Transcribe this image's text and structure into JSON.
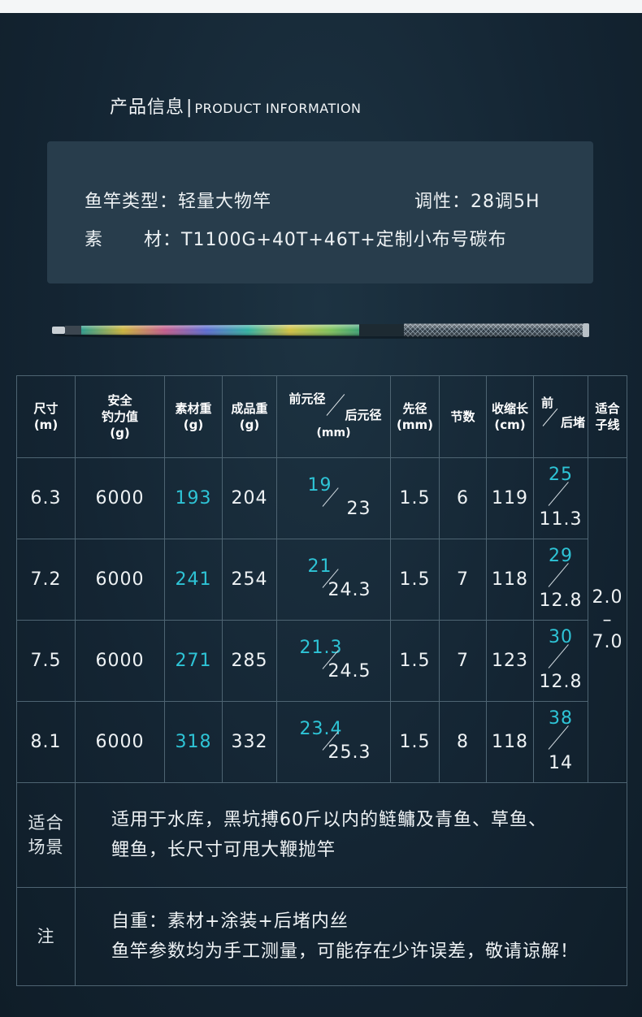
{
  "section": {
    "title_cn": "产品信息",
    "separator": "|",
    "title_en": "PRODUCT INFORMATION"
  },
  "info": {
    "type_label": "鱼竿类型：",
    "type_value": "轻量大物竿",
    "action_label": "调性：",
    "action_value": "28调5H",
    "material_label_1": "素",
    "material_label_2": "材：",
    "material_value": "T1100G+40T+46T+定制小布号碳布"
  },
  "table": {
    "headers": {
      "size": [
        "尺寸",
        "(m)"
      ],
      "safe_force": [
        "安全",
        "钓力值",
        "(g)"
      ],
      "raw_weight": [
        "素材重",
        "(g)"
      ],
      "final_weight": [
        "成品重",
        "(g)"
      ],
      "diam_front": "前元径",
      "diam_back": "后元径",
      "diam_unit": "(mm)",
      "tip": [
        "先径",
        "(mm)"
      ],
      "sections": "节数",
      "collapsed": [
        "收缩长",
        "(cm)"
      ],
      "plug_front": "前",
      "plug_back": "后堵",
      "line": [
        "适合",
        "子线"
      ]
    },
    "rows": [
      {
        "size": "6.3",
        "force": "6000",
        "raw": "193",
        "final": "204",
        "d_front": "19",
        "d_back": "23",
        "tip": "1.5",
        "sections": "6",
        "collapsed": "119",
        "p_front": "25",
        "p_back": "11.3"
      },
      {
        "size": "7.2",
        "force": "6000",
        "raw": "241",
        "final": "254",
        "d_front": "21",
        "d_back": "24.3",
        "tip": "1.5",
        "sections": "7",
        "collapsed": "118",
        "p_front": "29",
        "p_back": "12.8"
      },
      {
        "size": "7.5",
        "force": "6000",
        "raw": "271",
        "final": "285",
        "d_front": "21.3",
        "d_back": "24.5",
        "tip": "1.5",
        "sections": "7",
        "collapsed": "123",
        "p_front": "30",
        "p_back": "12.8"
      },
      {
        "size": "8.1",
        "force": "6000",
        "raw": "318",
        "final": "332",
        "d_front": "23.4",
        "d_back": "25.3",
        "tip": "1.5",
        "sections": "8",
        "collapsed": "118",
        "p_front": "38",
        "p_back": "14"
      }
    ],
    "line_range": [
      "2.0",
      "–",
      "7.0"
    ],
    "scene_label": [
      "适合",
      "场景"
    ],
    "scene_text": [
      "适用于水库，黑坑搏60斤以内的鲢鳙及青鱼、草鱼、",
      "鲤鱼，长尺寸可甩大鞭抛竿"
    ],
    "note_label": "注",
    "note_text": [
      "自重：素材+涂装+后堵内丝",
      "鱼竿参数均为手工测量，可能存在少许误差，敬请谅解！"
    ]
  },
  "colors": {
    "accent": "#2ec4d6",
    "background": "#142533",
    "panel": "#283d4c"
  }
}
